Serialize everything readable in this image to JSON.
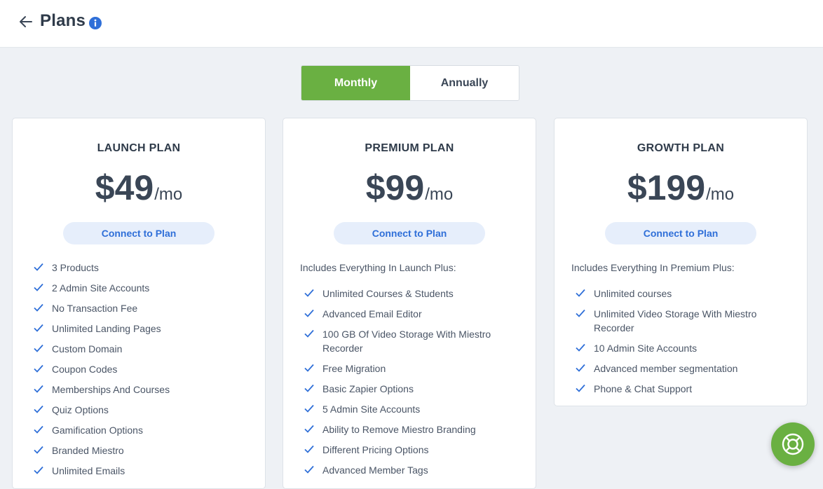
{
  "header": {
    "title": "Plans",
    "back_icon": "arrow-left-icon",
    "info_icon": "info-icon"
  },
  "billing_toggle": {
    "monthly": "Monthly",
    "annually": "Annually",
    "selected": "monthly"
  },
  "colors": {
    "accent": "#6ab042",
    "link": "#2f6fd8",
    "check": "#2f6fd8"
  },
  "plans": [
    {
      "name": "LAUNCH PLAN",
      "price": "$49",
      "period": "/mo",
      "button": "Connect to Plan",
      "intro": "",
      "features": [
        "3 Products",
        "2 Admin Site Accounts",
        "No Transaction Fee",
        "Unlimited Landing Pages",
        "Custom Domain",
        "Coupon Codes",
        "Memberships And Courses",
        "Quiz Options",
        "Gamification Options",
        "Branded Miestro",
        "Unlimited Emails"
      ]
    },
    {
      "name": "PREMIUM PLAN",
      "price": "$99",
      "period": "/mo",
      "button": "Connect to Plan",
      "intro": "Includes Everything In Launch Plus:",
      "features": [
        "Unlimited Courses & Students",
        "Advanced Email Editor",
        "100 GB Of Video Storage With Miestro Recorder",
        "Free Migration",
        "Basic Zapier Options",
        "5 Admin Site Accounts",
        "Ability to Remove Miestro Branding",
        "Different Pricing Options",
        "Advanced Member Tags"
      ]
    },
    {
      "name": "GROWTH PLAN",
      "price": "$199",
      "period": "/mo",
      "button": "Connect to Plan",
      "intro": "Includes Everything In Premium Plus:",
      "features": [
        "Unlimited courses",
        "Unlimited Video Storage With Miestro Recorder",
        "10 Admin Site Accounts",
        "Advanced member segmentation",
        "Phone & Chat Support"
      ]
    }
  ],
  "support": {
    "icon": "lifebuoy-icon"
  }
}
